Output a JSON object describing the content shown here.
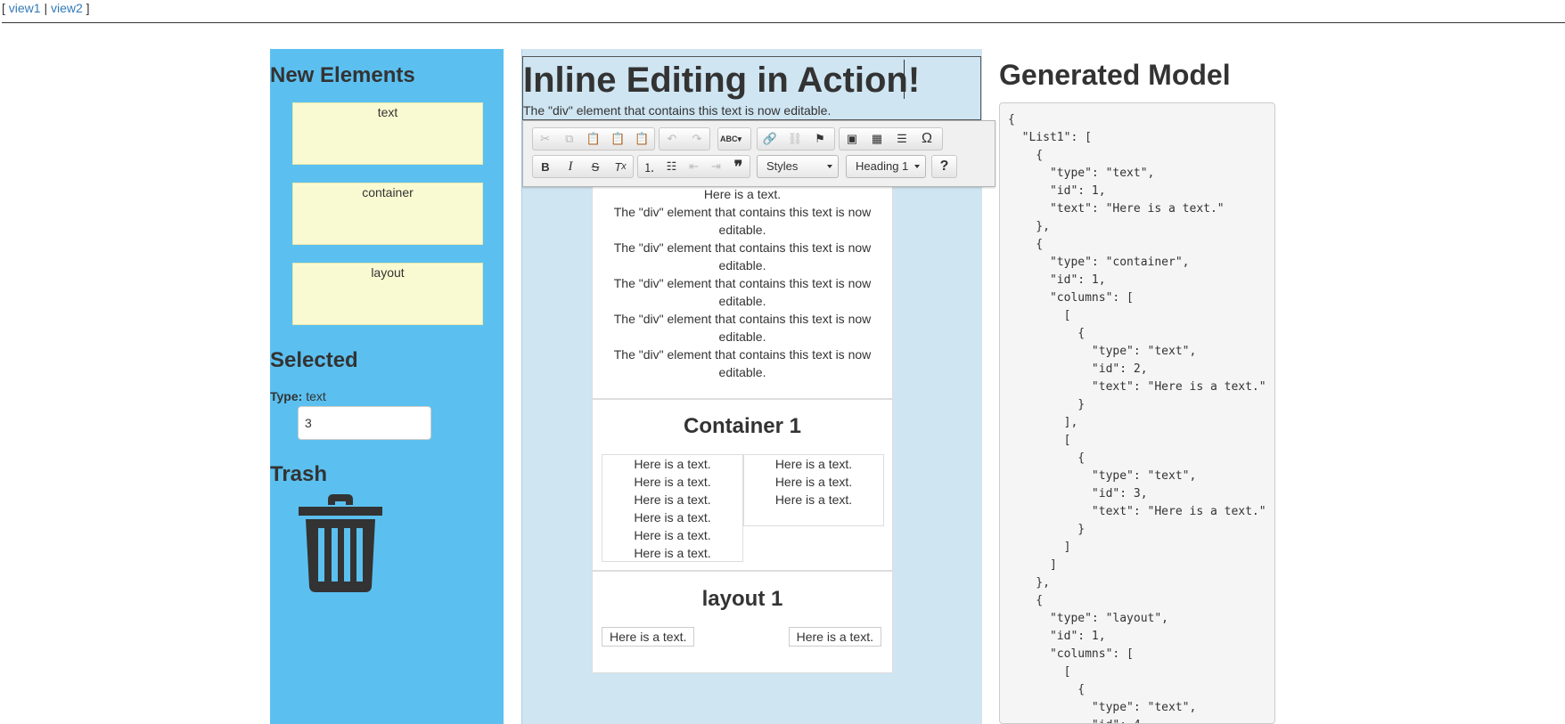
{
  "nav": {
    "open": "[ ",
    "view1": "view1",
    "sep": " | ",
    "view2": "view2",
    "close": " ]"
  },
  "left": {
    "new_elements_title": "New Elements",
    "palette": [
      "text",
      "container",
      "layout"
    ],
    "selected_title": "Selected",
    "type_label": "Type:",
    "type_value": "text",
    "selected_input_value": "3",
    "trash_title": "Trash"
  },
  "editor": {
    "heading": "Inline Editing in Action!",
    "intro": "The \"div\" element that contains this text is now editable.",
    "toolbar": {
      "styles": "Styles",
      "format": "Heading 1",
      "help": "?"
    },
    "text_card": {
      "first": "Here is a text.",
      "para_line1": "The \"div\" element that contains this text is now",
      "para_line2": "editable."
    },
    "container": {
      "title": "Container 1",
      "col1": [
        "Here is a text.",
        "Here is a text.",
        "Here is a text.",
        "Here is a text.",
        "Here is a text.",
        "Here is a text."
      ],
      "col2": [
        "Here is a text.",
        "Here is a text.",
        "Here is a text."
      ]
    },
    "layout": {
      "title": "layout 1",
      "left": "Here is a text.",
      "right": "Here is a text."
    }
  },
  "model": {
    "title": "Generated Model",
    "json_text": "{\n  \"List1\": [\n    {\n      \"type\": \"text\",\n      \"id\": 1,\n      \"text\": \"Here is a text.\"\n    },\n    {\n      \"type\": \"container\",\n      \"id\": 1,\n      \"columns\": [\n        [\n          {\n            \"type\": \"text\",\n            \"id\": 2,\n            \"text\": \"Here is a text.\"\n          }\n        ],\n        [\n          {\n            \"type\": \"text\",\n            \"id\": 3,\n            \"text\": \"Here is a text.\"\n          }\n        ]\n      ]\n    },\n    {\n      \"type\": \"layout\",\n      \"id\": 1,\n      \"columns\": [\n        [\n          {\n            \"type\": \"text\",\n            \"id\": 4,"
  }
}
